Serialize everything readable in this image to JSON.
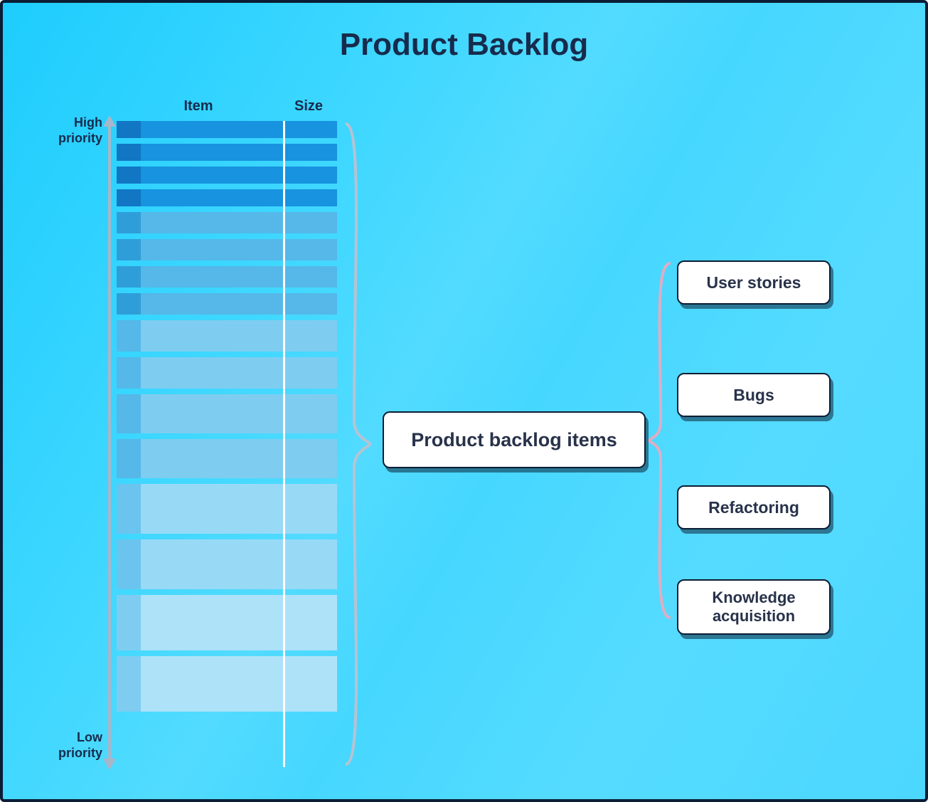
{
  "title": "Product Backlog",
  "columns": {
    "item": "Item",
    "size": "Size"
  },
  "priority_labels": {
    "high_line1": "High",
    "high_line2": "priority",
    "low_line1": "Low",
    "low_line2": "priority"
  },
  "backlog_rows": [
    {
      "shade": 0,
      "height": 0
    },
    {
      "shade": 0,
      "height": 0
    },
    {
      "shade": 0,
      "height": 0
    },
    {
      "shade": 0,
      "height": 0
    },
    {
      "shade": 1,
      "height": 1
    },
    {
      "shade": 1,
      "height": 1
    },
    {
      "shade": 1,
      "height": 1
    },
    {
      "shade": 1,
      "height": 1
    },
    {
      "shade": 2,
      "height": 2
    },
    {
      "shade": 2,
      "height": 2
    },
    {
      "shade": 2,
      "height": 3
    },
    {
      "shade": 2,
      "height": 3
    },
    {
      "shade": 3,
      "height": 4
    },
    {
      "shade": 3,
      "height": 4
    },
    {
      "shade": 4,
      "height": 5
    },
    {
      "shade": 4,
      "height": 5
    }
  ],
  "cards": {
    "main": "Product backlog items",
    "items": [
      "User stories",
      "Bugs",
      "Refactoring",
      "Knowledge acquisition"
    ]
  },
  "colors": {
    "text_dark": "#172b4d",
    "border_dark": "#0b1d34",
    "axis": "#a8b6c9",
    "bg_gradient_start": "#1ecdfe",
    "bg_gradient_end": "#4cd7ff"
  }
}
